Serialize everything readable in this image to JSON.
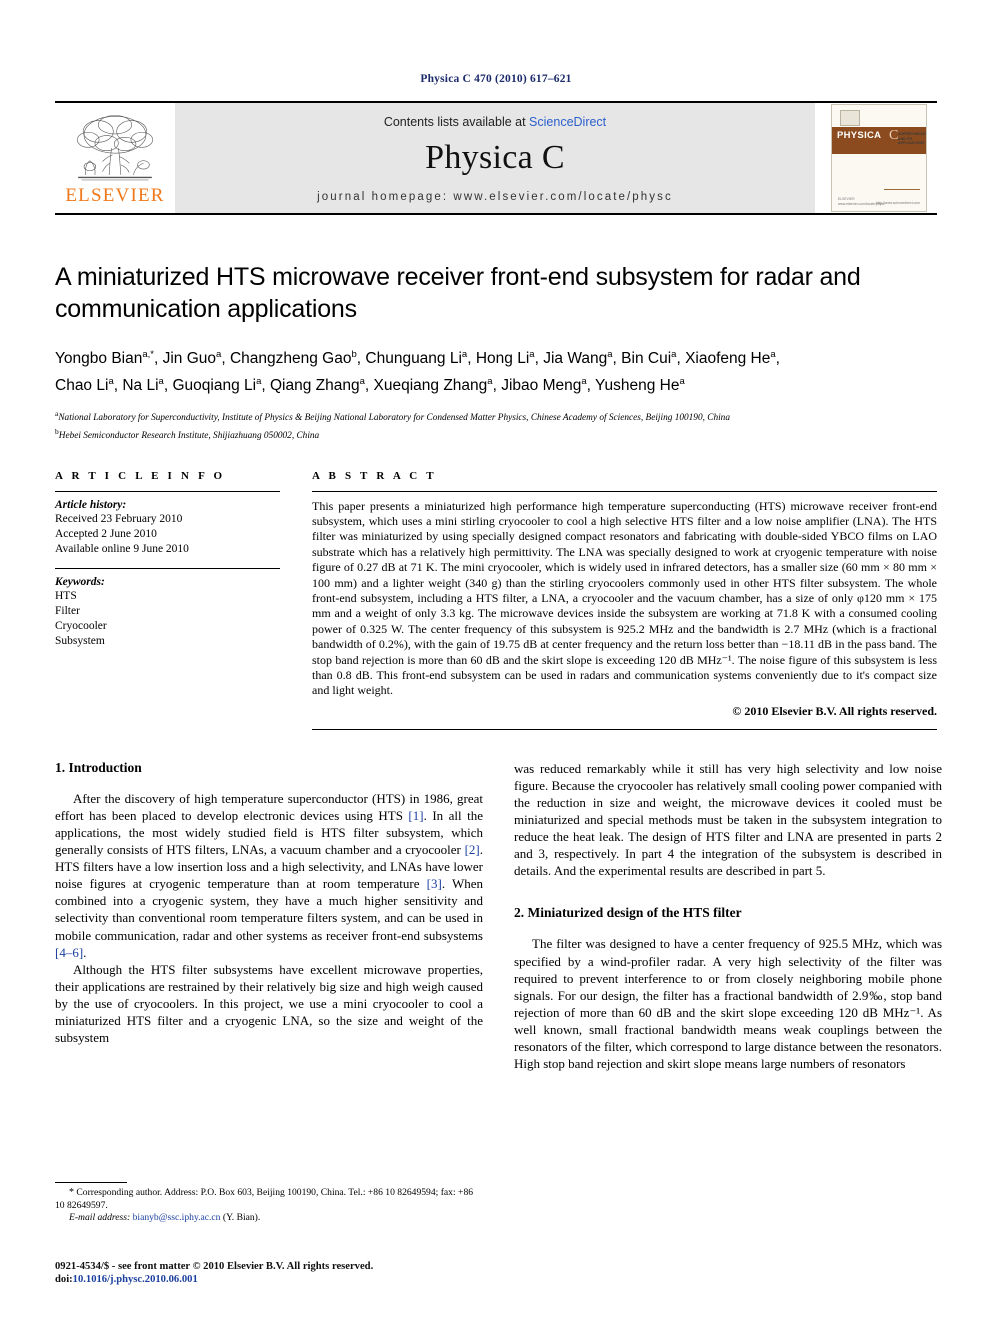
{
  "running_head": "Physica C 470 (2010) 617–621",
  "masthead": {
    "publisher_name": "ELSEVIER",
    "contents_prefix": "Contents lists available at ",
    "contents_link": "ScienceDirect",
    "journal_title": "Physica C",
    "homepage_line": "journal homepage: www.elsevier.com/locate/physc",
    "cover": {
      "band_title": "PHYSICA",
      "band_letter": "C",
      "subtitle": "SUPERCONDUCTIVITY AND ITS APPLICATIONS",
      "foot_left": "ELSEVIER",
      "foot_left2": "www.elsevier.com/locate/physc",
      "foot_right": "http://www.sciencedirect.com"
    }
  },
  "article": {
    "title": "A miniaturized HTS microwave receiver front-end subsystem for radar and communication applications",
    "authors_line1": "Yongbo Bian",
    "authors_line1_full": "Yongbo Bian a,*, Jin Guo a, Changzheng Gao b, Chunguang Li a, Hong Li a, Jia Wang a, Bin Cui a, Xiaofeng He a,",
    "authors_line2_full": "Chao Li a, Na Li a, Guoqiang Li a, Qiang Zhang a, Xueqiang Zhang a, Jibao Meng a, Yusheng He a",
    "authors": [
      {
        "name": "Yongbo Bian",
        "sup": "a,*"
      },
      {
        "name": "Jin Guo",
        "sup": "a"
      },
      {
        "name": "Changzheng Gao",
        "sup": "b"
      },
      {
        "name": "Chunguang Li",
        "sup": "a"
      },
      {
        "name": "Hong Li",
        "sup": "a"
      },
      {
        "name": "Jia Wang",
        "sup": "a"
      },
      {
        "name": "Bin Cui",
        "sup": "a"
      },
      {
        "name": "Xiaofeng He",
        "sup": "a"
      },
      {
        "name": "Chao Li",
        "sup": "a"
      },
      {
        "name": "Na Li",
        "sup": "a"
      },
      {
        "name": "Guoqiang Li",
        "sup": "a"
      },
      {
        "name": "Qiang Zhang",
        "sup": "a"
      },
      {
        "name": "Xueqiang Zhang",
        "sup": "a"
      },
      {
        "name": "Jibao Meng",
        "sup": "a"
      },
      {
        "name": "Yusheng He",
        "sup": "a"
      }
    ],
    "affiliations": [
      {
        "label": "a",
        "text": "National Laboratory for Superconductivity, Institute of Physics & Beijing National Laboratory for Condensed Matter Physics, Chinese Academy of Sciences, Beijing 100190, China"
      },
      {
        "label": "b",
        "text": "Hebei Semiconductor Research Institute, Shijiazhuang 050002, China"
      }
    ]
  },
  "article_info": {
    "heading": "A R T I C L E    I N F O",
    "history_label": "Article history:",
    "history": [
      "Received 23 February 2010",
      "Accepted 2 June 2010",
      "Available online 9 June 2010"
    ],
    "keywords_label": "Keywords:",
    "keywords": [
      "HTS",
      "Filter",
      "Cryocooler",
      "Subsystem"
    ]
  },
  "abstract": {
    "heading": "A B S T R A C T",
    "text": "This paper presents a miniaturized high performance high temperature superconducting (HTS) microwave receiver front-end subsystem, which uses a mini stirling cryocooler to cool a high selective HTS filter and a low noise amplifier (LNA). The HTS filter was miniaturized by using specially designed compact resonators and fabricating with double-sided YBCO films on LAO substrate which has a relatively high permittivity. The LNA was specially designed to work at cryogenic temperature with noise figure of 0.27 dB at 71 K. The mini cryocooler, which is widely used in infrared detectors, has a smaller size (60 mm × 80 mm × 100 mm) and a lighter weight (340 g) than the stirling cryocoolers commonly used in other HTS filter subsystem. The whole front-end subsystem, including a HTS filter, a LNA, a cryocooler and the vacuum chamber, has a size of only φ120 mm × 175 mm and a weight of only 3.3 kg. The microwave devices inside the subsystem are working at 71.8 K with a consumed cooling power of 0.325 W. The center frequency of this subsystem is 925.2 MHz and the bandwidth is 2.7 MHz (which is a fractional bandwidth of 0.2%), with the gain of 19.75 dB at center frequency and the return loss better than −18.11 dB in the pass band. The stop band rejection is more than 60 dB and the skirt slope is exceeding 120 dB MHz⁻¹. The noise figure of this subsystem is less than 0.8 dB. This front-end subsystem can be used in radars and communication systems conveniently due to it's compact size and light weight.",
    "copyright": "© 2010 Elsevier B.V. All rights reserved."
  },
  "sections": {
    "intro_heading": "1. Introduction",
    "intro_p1_a": "After the discovery of high temperature superconductor (HTS) in 1986, great effort has been placed to develop electronic devices using HTS ",
    "intro_p1_r1": "[1]",
    "intro_p1_b": ". In all the applications, the most widely studied field is HTS filter subsystem, which generally consists of HTS filters, LNAs, a vacuum chamber and a cryocooler ",
    "intro_p1_r2": "[2]",
    "intro_p1_c": ". HTS filters have a low insertion loss and a high selectivity, and LNAs have lower noise figures at cryogenic temperature than at room temperature ",
    "intro_p1_r3": "[3]",
    "intro_p1_d": ". When combined into a cryogenic system, they have a much higher sensitivity and selectivity than conventional room temperature filters system, and can be used in mobile communication, radar and other systems as receiver front-end subsystems ",
    "intro_p1_r4": "[4–6]",
    "intro_p1_e": ".",
    "intro_p2": "Although the HTS filter subsystems have excellent microwave properties, their applications are restrained by their relatively big size and high weigh caused by the use of cryocoolers. In this project, we use a mini cryocooler to cool a miniaturized HTS filter and a cryogenic LNA, so the size and weight of the subsystem",
    "right_p1": "was reduced remarkably while it still has very high selectivity and low noise figure. Because the cryocooler has relatively small cooling power companied with the reduction in size and weight, the microwave devices it cooled must be miniaturized and special methods must be taken in the subsystem integration to reduce the heat leak. The design of HTS filter and LNA are presented in parts 2 and 3, respectively. In part 4 the integration of the subsystem is described in details. And the experimental results are described in part 5.",
    "filter_heading": "2. Miniaturized design of the HTS filter",
    "filter_p1": "The filter was designed to have a center frequency of 925.5 MHz, which was specified by a wind-profiler radar. A very high selectivity of the filter was required to prevent interference to or from closely neighboring mobile phone signals. For our design, the filter has a fractional bandwidth of 2.9‰, stop band rejection of more than 60 dB and the skirt slope exceeding 120 dB MHz⁻¹. As well known, small fractional bandwidth means weak couplings between the resonators of the filter, which correspond to large distance between the resonators. High stop band rejection and skirt slope means large numbers of resonators"
  },
  "footnotes": {
    "corresponding_star": "*",
    "corresponding": " Corresponding author. Address: P.O. Box 603, Beijing 100190, China. Tel.: +86 10 82649594; fax: +86 10 82649597.",
    "email_label": "E-mail address:",
    "email": "bianyb@ssc.iphy.ac.cn",
    "email_suffix": " (Y. Bian)."
  },
  "imprint": {
    "line1": "0921-4534/$ - see front matter © 2010 Elsevier B.V. All rights reserved.",
    "doi_label": "doi:",
    "doi": "10.1016/j.physc.2010.06.001"
  },
  "colors": {
    "running_head": "#1b2a6b",
    "link": "#1b3fa0",
    "sciencedirect": "#2b5fcc",
    "elsevier_orange": "#f07818",
    "masthead_bg": "#e6e6e6",
    "cover_band": "#8c4b1e"
  }
}
